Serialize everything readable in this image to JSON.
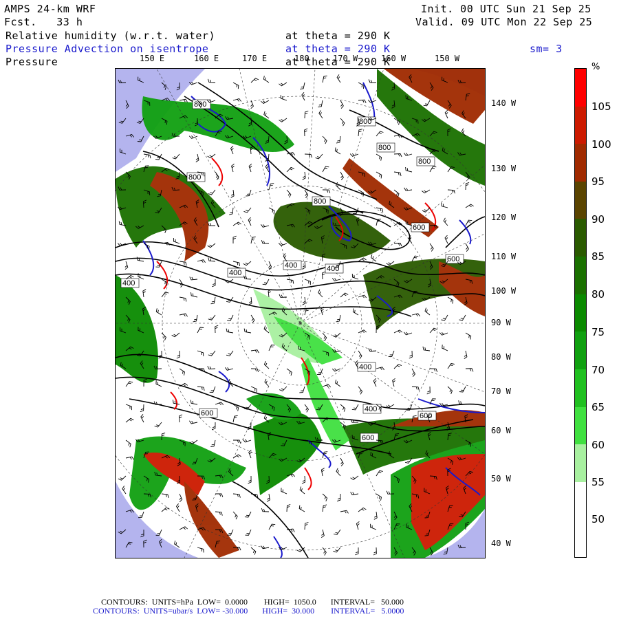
{
  "header": {
    "model": "AMPS 24-km WRF",
    "forecast": "Fcst.   33 h",
    "init": "Init. 00 UTC Sun 21 Sep 25",
    "valid": "Valid. 09 UTC Mon 22 Sep 25",
    "fields": [
      {
        "name": "Relative humidity (w.r.t. water)",
        "level": "at theta = 290 K",
        "color": "#000000"
      },
      {
        "name": "Pressure Advection on isentrope",
        "level": "at theta = 290 K",
        "extra": "sm= 3",
        "color": "#1a1acc"
      },
      {
        "name": "Pressure",
        "level": "at theta = 290 K",
        "color": "#000000"
      }
    ]
  },
  "lon_labels_top": [
    "150 E",
    "160 E",
    "170 E",
    "180",
    "170 W",
    "160 W",
    "150 W"
  ],
  "lat_labels_right": [
    "140 W",
    "130 W",
    "120 W",
    "110 W",
    "100 W",
    "90 W",
    "80 W",
    "70 W",
    "60 W",
    "50 W",
    "40 W"
  ],
  "contour_labels": [
    "800",
    "800",
    "800",
    "800",
    "800",
    "800",
    "600",
    "600",
    "400",
    "400",
    "400",
    "400",
    "400",
    "600",
    "400",
    "600",
    "600",
    "800"
  ],
  "colorbar": {
    "unit": "%",
    "ticks": [
      "105",
      "100",
      "95",
      "90",
      "85",
      "80",
      "75",
      "70",
      "65",
      "60",
      "55",
      "50"
    ],
    "colors": [
      "#ff0000",
      "#cc1a00",
      "#a02a00",
      "#5a4400",
      "#2a5a00",
      "#1a7000",
      "#0a8a00",
      "#10a010",
      "#20c020",
      "#40e040",
      "#a8f0a0",
      "#ffffff",
      "#ffffff"
    ]
  },
  "footer": {
    "line1": "CONTOURS:  UNITS=hPa  LOW=  0.0000        HIGH=  1050.0       INTERVAL=   50.000",
    "line2": "CONTOURS:  UNITS=ubar/s  LOW= -30.000       HIGH=  30.000        INTERVAL=   5.0000",
    "line1_color": "#000000",
    "line2_color": "#1a1acc"
  }
}
